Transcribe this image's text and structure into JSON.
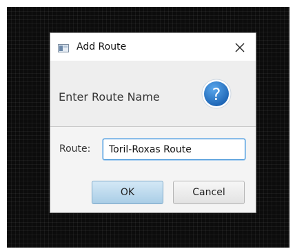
{
  "dialog": {
    "title": "Add Route",
    "header_text": "Enter Route Name",
    "route_label": "Route:",
    "route_value": "Toril-Roxas Route",
    "ok_label": "OK",
    "cancel_label": "Cancel"
  },
  "icons": {
    "app": "window-app-icon",
    "close": "close-icon",
    "help": "question-mark-icon"
  },
  "colors": {
    "help_blue": "#2c7fd1",
    "input_focus": "#3a8fd6",
    "ok_button": "#bcdcf0"
  }
}
